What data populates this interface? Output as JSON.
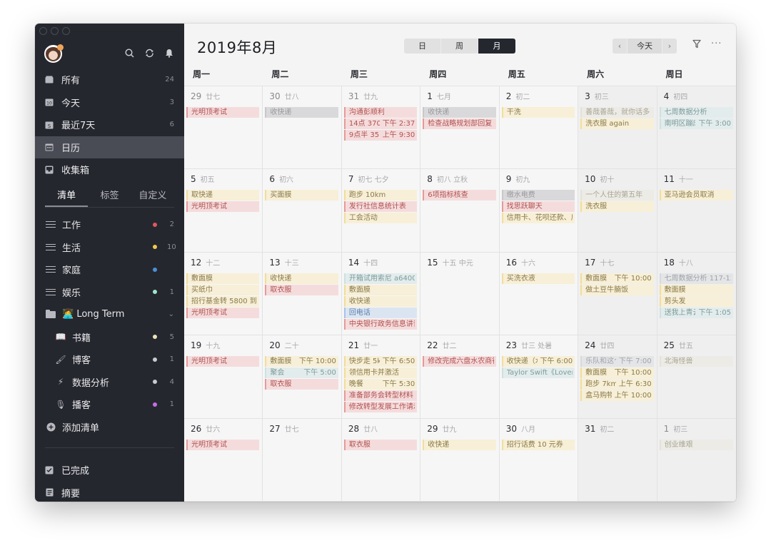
{
  "sidebar": {
    "nav": [
      {
        "icon": "inbox-all-icon",
        "label": "所有",
        "count": "24"
      },
      {
        "icon": "calendar-today-icon",
        "label": "今天",
        "count": "3"
      },
      {
        "icon": "calendar-7days-icon",
        "label": "最近7天",
        "count": "6"
      },
      {
        "icon": "calendar-icon",
        "label": "日历",
        "count": ""
      },
      {
        "icon": "inbox-icon",
        "label": "收集箱",
        "count": ""
      }
    ],
    "tabs": [
      "清单",
      "标签",
      "自定义"
    ],
    "lists": [
      {
        "icon": "list-icon",
        "label": "工作",
        "dot": "#e05a5a",
        "count": "2",
        "sub": false
      },
      {
        "icon": "list-icon",
        "label": "生活",
        "dot": "#f2c94c",
        "count": "10",
        "sub": false
      },
      {
        "icon": "list-icon",
        "label": "家庭",
        "dot": "#4a90d9",
        "count": "",
        "sub": false
      },
      {
        "icon": "list-icon",
        "label": "娱乐",
        "dot": "#9ee6cf",
        "count": "1",
        "sub": false
      },
      {
        "icon": "folder-icon",
        "label": "👩‍💻 Long Term",
        "dot": "",
        "count": "",
        "sub": false,
        "folder": true
      },
      {
        "icon": "book-icon",
        "label": "书籍",
        "dot": "#ece3b8",
        "count": "5",
        "sub": true,
        "emoji": "📖"
      },
      {
        "icon": "brush-icon",
        "label": "博客",
        "dot": "#c7ccd1",
        "count": "1",
        "sub": true,
        "emoji": "🖌"
      },
      {
        "icon": "lightning-icon",
        "label": "数据分析",
        "dot": "#c7ccd1",
        "count": "4",
        "sub": true,
        "emoji": "⚡"
      },
      {
        "icon": "microphone-icon",
        "label": "播客",
        "dot": "#c46ee8",
        "count": "1",
        "sub": true,
        "emoji": "🎙"
      }
    ],
    "add_list": "添加清单",
    "bottom": [
      {
        "icon": "checkbox-icon",
        "label": "已完成"
      },
      {
        "icon": "summary-icon",
        "label": "摘要"
      }
    ]
  },
  "header": {
    "title": "2019年8月",
    "view_modes": [
      "日",
      "周",
      "月"
    ],
    "active_view": "月",
    "today_label": "今天",
    "prev": "‹",
    "next": "›",
    "more": "···"
  },
  "weekdays": [
    "周一",
    "周二",
    "周三",
    "周四",
    "周五",
    "周六",
    "周日"
  ],
  "weeks": [
    [
      {
        "day": "29",
        "lunar": "廿七",
        "other": true,
        "events": [
          {
            "t": "光明顶考试",
            "c": "red"
          }
        ]
      },
      {
        "day": "30",
        "lunar": "廿八",
        "other": true,
        "events": [
          {
            "t": "收快递",
            "c": "gray"
          }
        ]
      },
      {
        "day": "31",
        "lunar": "廿九",
        "other": true,
        "events": [
          {
            "t": "沟通彭顺利",
            "c": "red"
          },
          {
            "t": "14点 3701 ³",
            "time": "下午 2:37",
            "c": "red"
          },
          {
            "t": "9点半 3519",
            "time": "上午 9:30",
            "c": "red"
          }
        ]
      },
      {
        "day": "1",
        "lunar": "七月",
        "events": [
          {
            "t": "收快递",
            "c": "gray"
          },
          {
            "t": "检查战略规划部回复",
            "c": "red"
          }
        ]
      },
      {
        "day": "2",
        "lunar": "初二",
        "events": [
          {
            "t": "干洗",
            "c": "yellow"
          }
        ]
      },
      {
        "day": "3",
        "lunar": "初三",
        "weekend": true,
        "events": [
          {
            "t": "善哉善哉，就你话多",
            "c": "beige"
          },
          {
            "t": "洗衣服 again",
            "c": "yellow"
          }
        ]
      },
      {
        "day": "4",
        "lunar": "初四",
        "weekend": true,
        "events": [
          {
            "t": "七周数据分析",
            "c": "teal"
          },
          {
            "t": "南明区蹦床",
            "time": "下午 3:00",
            "c": "teal"
          }
        ]
      }
    ],
    [
      {
        "day": "5",
        "lunar": "初五",
        "events": [
          {
            "t": "取快递",
            "c": "yellow"
          },
          {
            "t": "光明顶考试",
            "c": "red"
          }
        ]
      },
      {
        "day": "6",
        "lunar": "初六",
        "events": [
          {
            "t": "买面膜",
            "c": "yellow"
          }
        ]
      },
      {
        "day": "7",
        "lunar": "初七  七夕",
        "events": [
          {
            "t": "跑步 10km",
            "c": "yellow"
          },
          {
            "t": "发行社信息统计表",
            "c": "red"
          },
          {
            "t": "工会活动",
            "c": "yellow"
          }
        ]
      },
      {
        "day": "8",
        "lunar": "初八  立秋",
        "events": [
          {
            "t": "6项指标核查",
            "c": "red"
          }
        ]
      },
      {
        "day": "9",
        "lunar": "初九",
        "events": [
          {
            "t": "缴水电费",
            "c": "gray"
          },
          {
            "t": "找思跃聊天",
            "c": "red"
          },
          {
            "t": "信用卡、花呗还款、房",
            "c": "yellow"
          }
        ]
      },
      {
        "day": "10",
        "lunar": "初十",
        "weekend": true,
        "events": [
          {
            "t": "一个人住的第五年",
            "c": "beige"
          },
          {
            "t": "洗衣服",
            "c": "yellow"
          }
        ]
      },
      {
        "day": "11",
        "lunar": "十一",
        "weekend": true,
        "events": [
          {
            "t": "亚马逊会员取消",
            "c": "yellow"
          }
        ]
      }
    ],
    [
      {
        "day": "12",
        "lunar": "十二",
        "events": [
          {
            "t": "敷面膜",
            "c": "yellow"
          },
          {
            "t": "买纸巾",
            "c": "yellow"
          },
          {
            "t": "招行基金转 5800 到活",
            "c": "yellow"
          },
          {
            "t": "光明顶考试",
            "c": "red"
          }
        ]
      },
      {
        "day": "13",
        "lunar": "十三",
        "events": [
          {
            "t": "收快递",
            "c": "yellow"
          },
          {
            "t": "取衣服",
            "c": "red"
          }
        ]
      },
      {
        "day": "14",
        "lunar": "十四",
        "events": [
          {
            "t": "开箱试用索尼 a6400 ‹",
            "c": "teal"
          },
          {
            "t": "敷面膜",
            "c": "yellow"
          },
          {
            "t": "收快递",
            "c": "yellow"
          },
          {
            "t": "回电话",
            "c": "blue"
          },
          {
            "t": "中央银行政务信息讲评",
            "c": "red"
          }
        ]
      },
      {
        "day": "15",
        "lunar": "十五  中元",
        "events": []
      },
      {
        "day": "16",
        "lunar": "十六",
        "events": [
          {
            "t": "买洗衣液",
            "c": "yellow"
          }
        ]
      },
      {
        "day": "17",
        "lunar": "十七",
        "weekend": true,
        "events": [
          {
            "t": "敷面膜",
            "time": "下午 10:00",
            "c": "yellow"
          },
          {
            "t": "做土豆牛腩饭",
            "c": "yellow"
          }
        ]
      },
      {
        "day": "18",
        "lunar": "十八",
        "weekend": true,
        "events": [
          {
            "t": "七周数据分析 117-120",
            "c": "gray-light"
          },
          {
            "t": "敷面膜",
            "c": "yellow"
          },
          {
            "t": "剪头发",
            "c": "yellow"
          },
          {
            "t": "送我上青云",
            "time": "下午 1:05",
            "c": "teal"
          }
        ]
      }
    ],
    [
      {
        "day": "19",
        "lunar": "十九",
        "events": [
          {
            "t": "光明顶考试",
            "c": "red"
          }
        ]
      },
      {
        "day": "20",
        "lunar": "二十",
        "events": [
          {
            "t": "敷面膜",
            "time": "下午 10:00",
            "c": "yellow"
          },
          {
            "t": "聚会",
            "time": "下午 5:00",
            "c": "teal"
          },
          {
            "t": "取衣服",
            "c": "red"
          }
        ]
      },
      {
        "day": "21",
        "lunar": "廿一",
        "events": [
          {
            "t": "快步走 5km",
            "time": "下午 6:50",
            "c": "yellow"
          },
          {
            "t": "领信用卡并激活",
            "c": "yellow"
          },
          {
            "t": "晚餐",
            "time": "下午 5:30",
            "c": "yellow"
          },
          {
            "t": "准备部务会转型材料",
            "c": "red"
          },
          {
            "t": "修改转型发展工作请示",
            "c": "red"
          }
        ]
      },
      {
        "day": "22",
        "lunar": "廿二",
        "events": [
          {
            "t": "修改完成六盘水农商行",
            "c": "red"
          }
        ]
      },
      {
        "day": "23",
        "lunar": "廿三  处暑",
        "events": [
          {
            "t": "收快递（水‹",
            "time": "下午 6:00",
            "c": "yellow"
          },
          {
            "t": "Taylor Swift《Lover》",
            "c": "teal"
          }
        ]
      },
      {
        "day": "24",
        "lunar": "廿四",
        "weekend": true,
        "events": [
          {
            "t": "乐队和这个夏",
            "time": "下午 7:00",
            "c": "gray-light"
          },
          {
            "t": "敷面膜",
            "time": "下午 10:00",
            "c": "yellow"
          },
          {
            "t": "跑步 7km",
            "time": "上午 6:30",
            "c": "yellow"
          },
          {
            "t": "盒马购物",
            "time": "上午 10:00",
            "c": "yellow"
          }
        ]
      },
      {
        "day": "25",
        "lunar": "廿五",
        "weekend": true,
        "events": [
          {
            "t": "北海怪兽",
            "c": "beige"
          }
        ]
      }
    ],
    [
      {
        "day": "26",
        "lunar": "廿六",
        "events": [
          {
            "t": "光明顶考试",
            "c": "red"
          }
        ]
      },
      {
        "day": "27",
        "lunar": "廿七",
        "events": []
      },
      {
        "day": "28",
        "lunar": "廿八",
        "events": [
          {
            "t": "取衣服",
            "c": "red"
          }
        ]
      },
      {
        "day": "29",
        "lunar": "廿九",
        "events": [
          {
            "t": "收快递",
            "c": "yellow"
          }
        ]
      },
      {
        "day": "30",
        "lunar": "八月",
        "events": [
          {
            "t": "招行话费 10 元券",
            "c": "yellow"
          }
        ]
      },
      {
        "day": "31",
        "lunar": "初二",
        "weekend": true,
        "events": []
      },
      {
        "day": "1",
        "lunar": "初三",
        "other": true,
        "weekend": true,
        "events": [
          {
            "t": "创业维艰",
            "c": "beige"
          }
        ]
      }
    ]
  ]
}
